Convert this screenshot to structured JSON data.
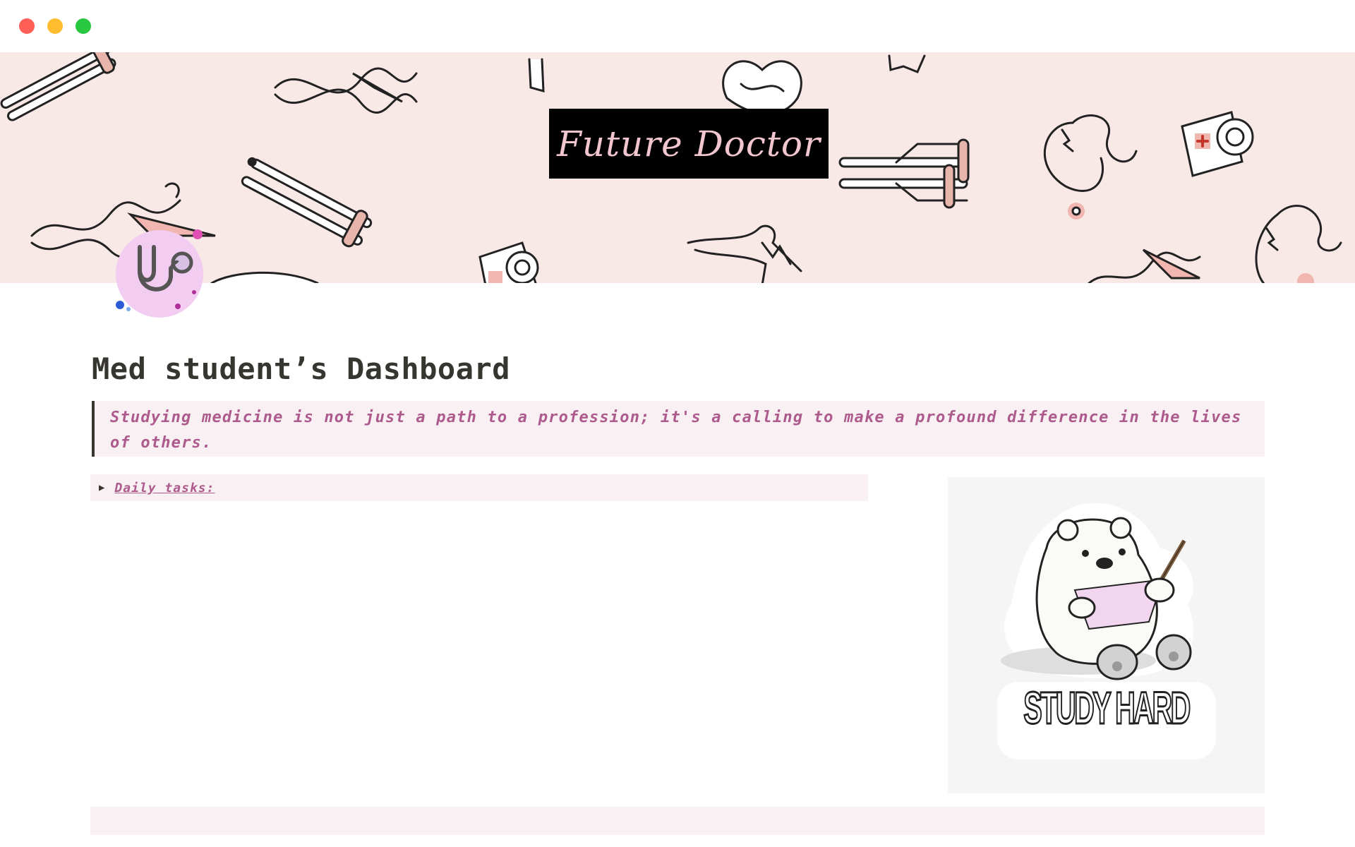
{
  "window": {
    "controls": [
      "close",
      "minimize",
      "maximize"
    ]
  },
  "cover": {
    "title": "Future Doctor",
    "background_color": "#f9e9e6",
    "pattern_icons": [
      "crutches-icon",
      "caduceus-icon",
      "heart-icon",
      "stethoscope-icon",
      "bandage-roll-icon",
      "bone-icon"
    ]
  },
  "page": {
    "icon": "stethoscope-icon",
    "title": "Med student’s Dashboard",
    "quote": "Studying medicine is not just a path to a profession; it's a calling to make a profound difference in the lives of others.",
    "toggle": {
      "label": "Daily tasks:",
      "state": "collapsed"
    },
    "sticker": {
      "text": "STUDY HARD",
      "image": "polar-bear-writing-icon"
    }
  },
  "colors": {
    "accent_text": "#ad5a8c",
    "block_background": "#f8f0f2",
    "title_text": "#37352f"
  }
}
